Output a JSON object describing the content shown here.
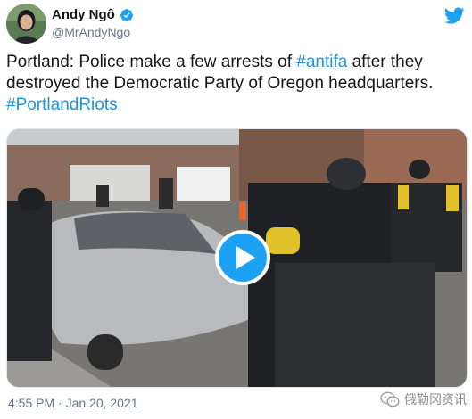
{
  "author": {
    "display_name": "Andy Ngô",
    "handle": "@MrAndyNgo",
    "verified": true
  },
  "tweet": {
    "text_before": "Portland: Police make a few arrests of ",
    "hashtag_1": "#antifa",
    "text_middle": " after they destroyed the Democratic Party of Oregon headquarters. ",
    "hashtag_2": "#PortlandRiots"
  },
  "media": {
    "type": "video",
    "play_icon": "play-icon"
  },
  "timestamp": "4:55 PM · Jan 20, 2021",
  "watermark": "俄勒冈资讯",
  "icons": {
    "logo": "twitter-bird-icon",
    "verified": "verified-badge-icon",
    "info": "info-icon",
    "watermark": "wechat-icon"
  },
  "colors": {
    "link": "#1b95e0",
    "brand": "#1da1f2",
    "text": "#14171a",
    "muted": "#657786"
  }
}
